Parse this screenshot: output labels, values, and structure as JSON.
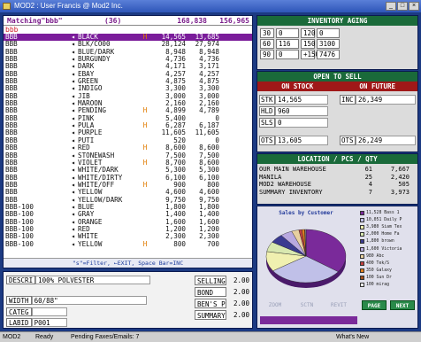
{
  "window": {
    "title": "MOD2 : User Francis @ Mod2 Inc."
  },
  "list": {
    "header": {
      "query": "Matching\"bbb\"",
      "count": "(36)",
      "total1": "168,838",
      "total2": "156,965"
    },
    "search_text": "bbb",
    "rows": [
      {
        "code": "BBB",
        "mark": "◂",
        "name": "BLACK",
        "flag": "H",
        "q1": "14,565",
        "q2": "13,685",
        "selected": true
      },
      {
        "code": "BBB",
        "mark": "◂",
        "name": "BLK/CO00",
        "flag": "",
        "q1": "28,124",
        "q2": "27,974"
      },
      {
        "code": "BBB",
        "mark": "◂",
        "name": "BLUE/DARK",
        "flag": "",
        "q1": "8,948",
        "q2": "8,948"
      },
      {
        "code": "BBB",
        "mark": "◂",
        "name": "BURGUNDY",
        "flag": "",
        "q1": "4,736",
        "q2": "4,736"
      },
      {
        "code": "BBB",
        "mark": "◂",
        "name": "DARK",
        "flag": "",
        "q1": "4,171",
        "q2": "3,171"
      },
      {
        "code": "BBB",
        "mark": "◂",
        "name": "EBAY",
        "flag": "",
        "q1": "4,257",
        "q2": "4,257"
      },
      {
        "code": "BBB",
        "mark": "◂",
        "name": "GREEN",
        "flag": "",
        "q1": "4,875",
        "q2": "4,875"
      },
      {
        "code": "BBB",
        "mark": "◂",
        "name": "INDIGO",
        "flag": "",
        "q1": "3,300",
        "q2": "3,300"
      },
      {
        "code": "BBB",
        "mark": "◂",
        "name": "JIB",
        "flag": "",
        "q1": "3,000",
        "q2": "3,000"
      },
      {
        "code": "BBB",
        "mark": "◂",
        "name": "MAROON",
        "flag": "",
        "q1": "2,160",
        "q2": "2,160"
      },
      {
        "code": "BBB",
        "mark": "◂",
        "name": "PENDING",
        "flag": "H",
        "q1": "4,899",
        "q2": "4,789"
      },
      {
        "code": "BBB",
        "mark": "◂",
        "name": "PINK",
        "flag": "",
        "q1": "5,400",
        "q2": "0"
      },
      {
        "code": "BBB",
        "mark": "◂",
        "name": "PULA",
        "flag": "H",
        "q1": "6,287",
        "q2": "6,187"
      },
      {
        "code": "BBB",
        "mark": "◂",
        "name": "PURPLE",
        "flag": "",
        "q1": "11,605",
        "q2": "11,605"
      },
      {
        "code": "BBB",
        "mark": "◂",
        "name": "PUTI",
        "flag": "",
        "q1": "520",
        "q2": "0"
      },
      {
        "code": "BBB",
        "mark": "◂",
        "name": "RED",
        "flag": "H",
        "q1": "8,600",
        "q2": "8,600"
      },
      {
        "code": "BBB",
        "mark": "◂",
        "name": "STONEWASH",
        "flag": "",
        "q1": "7,500",
        "q2": "7,500"
      },
      {
        "code": "BBB",
        "mark": "◂",
        "name": "VIOLET",
        "flag": "H",
        "q1": "8,700",
        "q2": "8,600"
      },
      {
        "code": "BBB",
        "mark": "◂",
        "name": "WHITE/DARK",
        "flag": "",
        "q1": "5,300",
        "q2": "5,300"
      },
      {
        "code": "BBB",
        "mark": "◂",
        "name": "WHITE/DIRTY",
        "flag": "",
        "q1": "6,100",
        "q2": "6,100"
      },
      {
        "code": "BBB",
        "mark": "◂",
        "name": "WHITE/OFF",
        "flag": "H",
        "q1": "900",
        "q2": "800"
      },
      {
        "code": "BBB",
        "mark": "◂",
        "name": "YELLOW",
        "flag": "",
        "q1": "4,600",
        "q2": "4,600"
      },
      {
        "code": "BBB",
        "mark": "◂",
        "name": "YELLOW/DARK",
        "flag": "",
        "q1": "9,750",
        "q2": "9,750"
      },
      {
        "code": "BBB-100",
        "mark": "◂",
        "name": "BLUE",
        "flag": "",
        "q1": "1,800",
        "q2": "1,800"
      },
      {
        "code": "BBB-100",
        "mark": "◂",
        "name": "GRAY",
        "flag": "",
        "q1": "1,400",
        "q2": "1,400"
      },
      {
        "code": "BBB-100",
        "mark": "◂",
        "name": "ORANGE",
        "flag": "",
        "q1": "1,600",
        "q2": "1,600"
      },
      {
        "code": "BBB-100",
        "mark": "◂",
        "name": "RED",
        "flag": "",
        "q1": "1,200",
        "q2": "1,200"
      },
      {
        "code": "BBB-100",
        "mark": "◂",
        "name": "WHITE",
        "flag": "",
        "q1": "2,300",
        "q2": "2,300"
      },
      {
        "code": "BBB-100",
        "mark": "◂",
        "name": "YELLOW",
        "flag": "H",
        "q1": "800",
        "q2": "700"
      }
    ],
    "footer": "\"s\"=Filter, ←EXIT, Space Bar=INC"
  },
  "details": {
    "descr_label": "DESCRI",
    "descr_value": "100% POLVESTER",
    "width_label": "WIDTH",
    "width_value": "60/88\"",
    "categ_label": "CATEG",
    "categ_value": "",
    "labid_label": "LABID",
    "labid_value": "P001",
    "prices": [
      {
        "label": "SELLING",
        "value": "2.00"
      },
      {
        "label": "BOND",
        "value": "2.00"
      },
      {
        "label": "BEN'S P",
        "value": "2.00"
      },
      {
        "label": "SUMMARY",
        "value": "2.00"
      }
    ]
  },
  "aging": {
    "title": "INVENTORY AGING",
    "cells": [
      "30",
      "0",
      "120",
      "0",
      "60",
      "116",
      "150",
      "3100",
      "90",
      "0",
      "+150",
      "7476"
    ]
  },
  "open_to_sell": {
    "title": "OPEN TO SELL",
    "on_stock": "ON STOCK",
    "on_future": "ON FUTURE",
    "stk_label": "STK",
    "stk_value": "14,565",
    "hld_label": "HLD",
    "hld_value": "960",
    "sls_label": "SLS",
    "sls_value": "0",
    "ots_label": "OTS",
    "ots_value": "13,605",
    "inc_label": "INC",
    "inc_value": "26,349",
    "ots2_label": "OTS",
    "ots2_value": "26,249"
  },
  "location": {
    "title": "LOCATION / PCS / QTY",
    "rows": [
      {
        "name": "OUR MAIN WAREHOUSE",
        "pcs": "61",
        "qty": "7,667"
      },
      {
        "name": "MANILA",
        "pcs": "25",
        "qty": "2,420"
      },
      {
        "name": "MOD2 WAREHOUSE",
        "pcs": "4",
        "qty": "505"
      },
      {
        "name": "SUMMARY INVENTORY",
        "pcs": "7",
        "qty": "3,973"
      }
    ]
  },
  "sales": {
    "title": "Sales by Customer",
    "legend": [
      {
        "label": "11,528 Bass 1",
        "color": "#7a2a9a"
      },
      {
        "label": "10,051 Daily P",
        "color": "#c0c0e8"
      },
      {
        "label": "3,980 Siam Tex",
        "color": "#f0f0b0"
      },
      {
        "label": "2,000 Home Fa",
        "color": "#d8e8b0"
      },
      {
        "label": "1,800 brown",
        "color": "#3a3a90"
      },
      {
        "label": "1,600 Victoria",
        "color": "#b8a8e0"
      },
      {
        "label": "980 Abc",
        "color": "#e8d0a0"
      },
      {
        "label": "400 Tek/S",
        "color": "#c04040"
      },
      {
        "label": "350 Galaxy",
        "color": "#e08020"
      },
      {
        "label": "100 Sun Dr",
        "color": "#a05020"
      },
      {
        "label": "100 mirag",
        "color": "#f0f0f0"
      }
    ],
    "buttons": [
      {
        "label": "ZOOM",
        "active": false
      },
      {
        "label": "SCTN",
        "active": false
      },
      {
        "label": "REVIT",
        "active": false
      },
      {
        "label": "PAGE",
        "active": true
      },
      {
        "label": "NEXT",
        "active": true
      }
    ]
  },
  "statusbar": {
    "app": "MOD2",
    "state": "Ready",
    "pending": "Pending Faxes/Emails: 7",
    "whats": "What's New"
  }
}
